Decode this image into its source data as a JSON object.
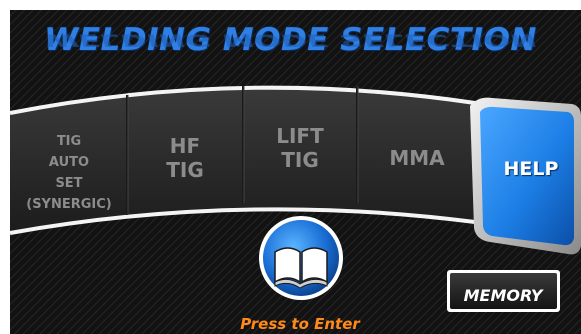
{
  "screen": {
    "title": "WELDING MODE SELECTION"
  },
  "modes": [
    {
      "label": "TIG\nAUTO\nSET\n(SYNERGIC)"
    },
    {
      "label": "HF\nTIG"
    },
    {
      "label": "LIFT\nTIG"
    },
    {
      "label": "MMA"
    }
  ],
  "help_button": {
    "label": "HELP"
  },
  "manual_button": {
    "icon": "book-icon",
    "caption": "Press to Enter"
  },
  "memory_button": {
    "label": "MEMORY"
  },
  "colors": {
    "title_blue": "#2f7fe4",
    "help_blue": "#1d7fe6",
    "accent_orange": "#ff8a1a",
    "panel_dark": "#2a2a2a"
  }
}
